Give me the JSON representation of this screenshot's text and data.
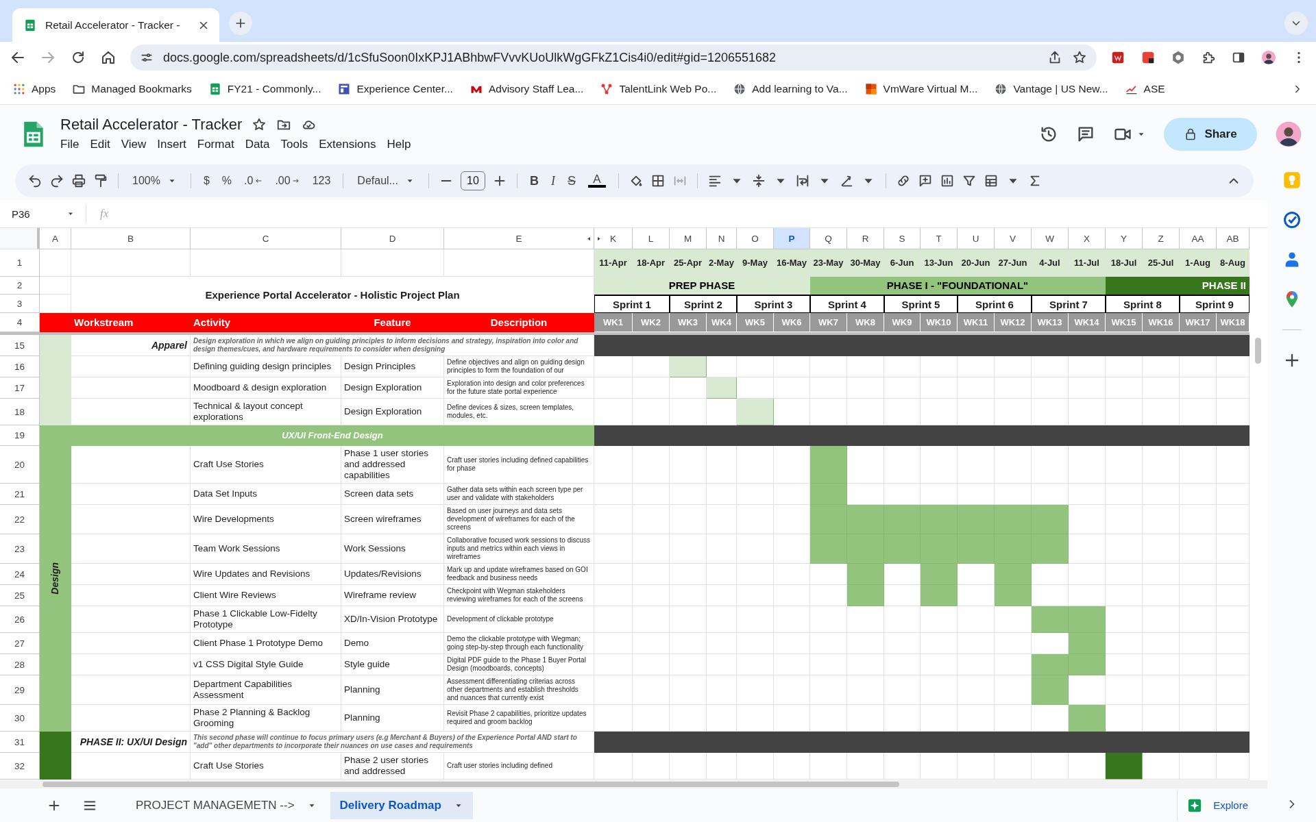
{
  "browser": {
    "tab": {
      "title": "Retail Accelerator - Tracker -",
      "selected": true
    },
    "url": "docs.google.com/spreadsheets/d/1cSfuSoon0IxKPJ1ABhbwFVvvKUoUlkWgGFkZ1Cis4i0/edit#gid=1206551682",
    "bookmarks": [
      "Apps",
      "Managed Bookmarks",
      "FY21 - Commonly...",
      "Experience Center...",
      "Advisory Staff Lea...",
      "TalentLink Web Po...",
      "Add learning to Va...",
      "VmWare Virtual M...",
      "Vantage | US New...",
      "ASE"
    ]
  },
  "document": {
    "title": "Retail Accelerator - Tracker",
    "menu": [
      "File",
      "Edit",
      "View",
      "Insert",
      "Format",
      "Data",
      "Tools",
      "Extensions",
      "Help"
    ],
    "share": "Share"
  },
  "toolbar": {
    "zoom": "100%",
    "currency": "$",
    "percent": "%",
    "decimal_decrease": ".0",
    "decimal_increase": ".00",
    "number_format": "123",
    "font": "Defaul...",
    "font_size": "10",
    "bold": "B",
    "italic": "I",
    "strikethrough": "S",
    "text_color": "A"
  },
  "formula_bar": {
    "cell": "P36",
    "fx": "fx"
  },
  "sheet": {
    "columns": [
      {
        "label": "A",
        "selected": false
      },
      {
        "label": "B",
        "selected": false
      },
      {
        "label": "C",
        "selected": false
      },
      {
        "label": "D",
        "selected": false
      },
      {
        "label": "E",
        "selected": false
      }
    ],
    "top_rows": [
      "1",
      "2",
      "3",
      "4"
    ],
    "title": "Experience Portal Accelerator - Holistic Project Plan",
    "headers": [
      "Workstream",
      "Activity",
      "Feature",
      "Description"
    ],
    "phases": [
      {
        "label": "PREP PHASE",
        "color": "#d9ead3",
        "sprints": [
          {
            "label": "Sprint 1",
            "weeks": [
              {
                "column": "K",
                "selected": false,
                "date": "11-Apr",
                "label": "WK1"
              },
              {
                "column": "L",
                "selected": false,
                "date": "18-Apr",
                "label": "WK2"
              }
            ]
          },
          {
            "label": "Sprint 2",
            "weeks": [
              {
                "column": "M",
                "selected": false,
                "date": "25-Apr",
                "label": "WK3"
              },
              {
                "column": "N",
                "selected": false,
                "date": "2-May",
                "label": "WK4"
              }
            ]
          },
          {
            "label": "Sprint 3",
            "weeks": [
              {
                "column": "O",
                "selected": false,
                "date": "9-May",
                "label": "WK5"
              },
              {
                "column": "P",
                "selected": true,
                "date": "16-May",
                "label": "WK6"
              }
            ]
          }
        ]
      },
      {
        "label": "PHASE I - \"FOUNDATIONAL\"",
        "color": "#93c47d",
        "sprints": [
          {
            "label": "Sprint 4",
            "weeks": [
              {
                "column": "Q",
                "selected": false,
                "date": "23-May",
                "label": "WK7"
              },
              {
                "column": "R",
                "selected": false,
                "date": "30-May",
                "label": "WK8"
              }
            ]
          },
          {
            "label": "Sprint 5",
            "weeks": [
              {
                "column": "S",
                "selected": false,
                "date": "6-Jun",
                "label": "WK9"
              },
              {
                "column": "T",
                "selected": false,
                "date": "13-Jun",
                "label": "WK10"
              }
            ]
          },
          {
            "label": "Sprint 6",
            "weeks": [
              {
                "column": "U",
                "selected": false,
                "date": "20-Jun",
                "label": "WK11"
              },
              {
                "column": "V",
                "selected": false,
                "date": "27-Jun",
                "label": "WK12"
              }
            ]
          },
          {
            "label": "Sprint 7",
            "weeks": [
              {
                "column": "W",
                "selected": false,
                "date": "4-Jul",
                "label": "WK13"
              },
              {
                "column": "X",
                "selected": false,
                "date": "11-Jul",
                "label": "WK14"
              }
            ]
          }
        ]
      },
      {
        "label": "PHASE II",
        "color": "#38761d",
        "sprints": [
          {
            "label": "Sprint 8",
            "weeks": [
              {
                "column": "Y",
                "selected": false,
                "date": "18-Jul",
                "label": "WK15"
              },
              {
                "column": "Z",
                "selected": false,
                "date": "25-Jul",
                "label": "WK16"
              }
            ]
          },
          {
            "label": "Sprint 9",
            "weeks": [
              {
                "column": "AA",
                "selected": false,
                "date": "1-Aug",
                "label": "WK17"
              },
              {
                "column": "AB",
                "selected": false,
                "date": "8-Aug",
                "label": "WK18"
              }
            ]
          }
        ]
      }
    ],
    "groups": [
      {
        "color": "#d9ead3",
        "rows": [
          {
            "number": "15",
            "kind": "section",
            "workstream": "Apparel",
            "description": "Design exploration in which we align on guiding principles to inform decisions and strategy, inspiration into color and design themes/cues, and hardware requirements to consider when designing"
          },
          {
            "number": "16",
            "kind": "task",
            "activity": "Defining guiding design principles",
            "feature": "Design Principles",
            "description": "Define objectives and align on guiding design principles to form the foundation of our",
            "color": "#d9ead3",
            "weeks": [
              false,
              false,
              true,
              false,
              false,
              false,
              false,
              false,
              false,
              false,
              false,
              false,
              false,
              false,
              false,
              false,
              false,
              false
            ]
          },
          {
            "number": "17",
            "kind": "task",
            "activity": "Moodboard & design exploration",
            "feature": "Design Exploration",
            "description": "Exploration into design and color preferences for the future state portal experience",
            "color": "#d9ead3",
            "weeks": [
              false,
              false,
              false,
              true,
              false,
              false,
              false,
              false,
              false,
              false,
              false,
              false,
              false,
              false,
              false,
              false,
              false,
              false
            ]
          },
          {
            "number": "18",
            "kind": "task",
            "activity": "Technical & layout concept explorations",
            "feature": "Design Exploration",
            "description": "Define devices & sizes, screen templates, modules, etc.",
            "color": "#d9ead3",
            "weeks": [
              false,
              false,
              false,
              false,
              true,
              false,
              false,
              false,
              false,
              false,
              false,
              false,
              false,
              false,
              false,
              false,
              false,
              false
            ]
          }
        ]
      },
      {
        "label": "Design",
        "color": "#93c47d",
        "rows": [
          {
            "number": "19",
            "kind": "banner",
            "title": "UX/UI Front-End Design"
          },
          {
            "number": "20",
            "kind": "task",
            "activity": "Craft Use Stories",
            "feature": "Phase 1 user stories and addressed capabilities",
            "description": "Craft user stories including defined capabilities for phase",
            "color": "#93c47d",
            "weeks": [
              false,
              false,
              false,
              false,
              false,
              false,
              true,
              false,
              false,
              false,
              false,
              false,
              false,
              false,
              false,
              false,
              false,
              false
            ]
          },
          {
            "number": "21",
            "kind": "task",
            "activity": "Data Set Inputs",
            "feature": "Screen data sets",
            "description": "Gather data sets within each screen type per user and validate with stakeholders",
            "color": "#93c47d",
            "weeks": [
              false,
              false,
              false,
              false,
              false,
              false,
              true,
              false,
              false,
              false,
              false,
              false,
              false,
              false,
              false,
              false,
              false,
              false
            ]
          },
          {
            "number": "22",
            "kind": "task",
            "activity": "Wire Developments",
            "feature": "Screen wireframes",
            "description": "Based on user journeys and data sets development of wireframes for each of the screens",
            "color": "#93c47d",
            "weeks": [
              false,
              false,
              false,
              false,
              false,
              false,
              true,
              true,
              true,
              true,
              true,
              true,
              true,
              false,
              false,
              false,
              false,
              false
            ]
          },
          {
            "number": "23",
            "kind": "task",
            "activity": "Team Work Sessions",
            "feature": "Work Sessions",
            "description": "Collaborative focused work sessions to discuss inputs and metrics within each views in wireframes",
            "color": "#93c47d",
            "weeks": [
              false,
              false,
              false,
              false,
              false,
              false,
              true,
              true,
              true,
              true,
              true,
              true,
              true,
              false,
              false,
              false,
              false,
              false
            ]
          },
          {
            "number": "24",
            "kind": "task",
            "activity": "Wire Updates and Revisions",
            "feature": "Updates/Revisions",
            "description": "Mark up and update wireframes based on GOI feedback and business needs",
            "color": "#93c47d",
            "weeks": [
              false,
              false,
              false,
              false,
              false,
              false,
              false,
              true,
              false,
              true,
              false,
              true,
              false,
              false,
              false,
              false,
              false,
              false
            ]
          },
          {
            "number": "25",
            "kind": "task",
            "activity": "Client Wire Reviews",
            "feature": "Wireframe review",
            "description": "Checkpoint with Wegman stakeholders reviewing wireframes for each of the screens",
            "color": "#93c47d",
            "weeks": [
              false,
              false,
              false,
              false,
              false,
              false,
              false,
              true,
              false,
              true,
              false,
              true,
              false,
              false,
              false,
              false,
              false,
              false
            ]
          },
          {
            "number": "26",
            "kind": "task",
            "activity": "Phase 1 Clickable Low-Fidelty Prototype",
            "feature": "XD/In-Vision Prototype",
            "description": "Development of clickable prototype",
            "color": "#93c47d",
            "weeks": [
              false,
              false,
              false,
              false,
              false,
              false,
              false,
              false,
              false,
              false,
              false,
              false,
              true,
              true,
              false,
              false,
              false,
              false
            ]
          },
          {
            "number": "27",
            "kind": "task",
            "activity": "Client Phase 1 Prototype Demo",
            "feature": "Demo",
            "description": "Demo the clickable prototype with Wegman; going step-by-step through each functionality",
            "color": "#93c47d",
            "weeks": [
              false,
              false,
              false,
              false,
              false,
              false,
              false,
              false,
              false,
              false,
              false,
              false,
              false,
              true,
              false,
              false,
              false,
              false
            ]
          },
          {
            "number": "28",
            "kind": "task",
            "activity": "v1 CSS Digital Style Guide",
            "feature": "Style guide",
            "description": "Digital PDF guide to the Phase 1 Buyer Portal Design (moodboards, concepts)",
            "color": "#93c47d",
            "weeks": [
              false,
              false,
              false,
              false,
              false,
              false,
              false,
              false,
              false,
              false,
              false,
              false,
              true,
              true,
              false,
              false,
              false,
              false
            ]
          },
          {
            "number": "29",
            "kind": "task",
            "activity": "Department Capabilities Assessment",
            "feature": "Planning",
            "description": "Assessment differentiating criterias across other departments and establish thresholds and nuances that currently exist",
            "color": "#93c47d",
            "weeks": [
              false,
              false,
              false,
              false,
              false,
              false,
              false,
              false,
              false,
              false,
              false,
              false,
              true,
              false,
              false,
              false,
              false,
              false
            ]
          },
          {
            "number": "30",
            "kind": "task",
            "activity": "Phase 2 Planning & Backlog Grooming",
            "feature": "Planning",
            "description": "Revisit Phase 2 capabilities, prioritize updates required and groom backlog",
            "color": "#93c47d",
            "weeks": [
              false,
              false,
              false,
              false,
              false,
              false,
              false,
              false,
              false,
              false,
              false,
              false,
              false,
              true,
              false,
              false,
              false,
              false
            ]
          }
        ]
      },
      {
        "color": "#38761d",
        "rows": [
          {
            "number": "31",
            "kind": "section",
            "workstream": "PHASE II: UX/UI Design",
            "description": "This second phase will continue to focus primary users (e.g Merchant & Buyers) of the Experience Portal AND start to \"add\" other departments to incorporate their nuances on use cases and requirements"
          },
          {
            "number": "32",
            "kind": "task",
            "activity": "Craft Use Stories",
            "feature": "Phase 2 user stories and addressed",
            "description": "Craft user stories including defined",
            "color": "#38761d",
            "weeks": [
              false,
              false,
              false,
              false,
              false,
              false,
              false,
              false,
              false,
              false,
              false,
              false,
              false,
              false,
              true,
              false,
              false,
              false
            ]
          }
        ]
      }
    ]
  },
  "sheet_tabs": [
    {
      "label": "PROJECT MANAGEMETN -->",
      "selected": false
    },
    {
      "label": "Delivery Roadmap",
      "selected": true
    }
  ],
  "explore": "Explore"
}
